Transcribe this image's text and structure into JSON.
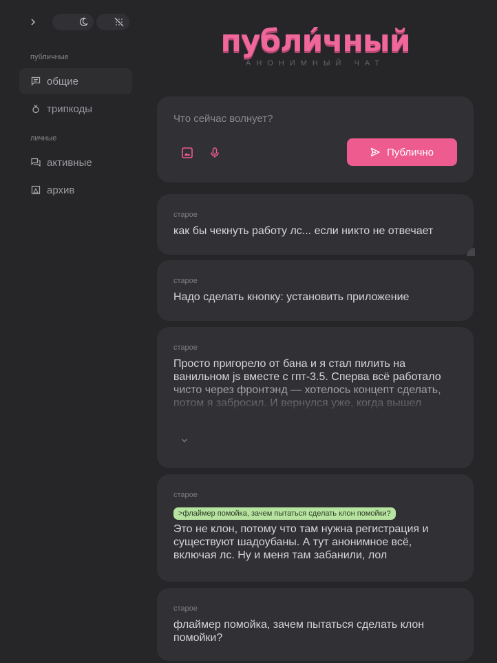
{
  "sidebar": {
    "sections": [
      {
        "label": "публичные",
        "items": [
          {
            "label": "общие",
            "icon": "chat-icon",
            "active": true
          },
          {
            "label": "трипкоды",
            "icon": "ring-icon",
            "active": false
          }
        ]
      },
      {
        "label": "личные",
        "items": [
          {
            "label": "активные",
            "icon": "conversations-icon",
            "active": false
          },
          {
            "label": "архив",
            "icon": "archive-icon",
            "active": false
          }
        ]
      }
    ]
  },
  "header": {
    "logo": "публи́чный",
    "subtitle": "анонимный чат"
  },
  "composer": {
    "placeholder": "Что сейчас волнует?",
    "publish_label": "Публично"
  },
  "posts": [
    {
      "meta": "старое",
      "text": "как бы чекнуть работу лс... если никто не отвечает"
    },
    {
      "meta": "старое",
      "text": "Надо сделать кнопку: установить приложение"
    },
    {
      "meta": "старое",
      "text": "Просто пригорело от бана и я стал пилить на ванильном js вместе с гпт-3.5. Сперва всё работало чисто через фронтэнд — хотелось концепт сделать, потом я забросил. И вернулся уже, когда вышел кодекс. Вместе с ним сделали бэкенд"
    },
    {
      "meta": "старое",
      "quote": ">флаймер помойка, зачем пытаться сделать клон помойки?",
      "text": "Это не клон, потому что там нужна регистрация и существуют шадоубаны. А тут анонимное всё, включая лс. Ну и меня там забанили, лол"
    },
    {
      "meta": "старое",
      "text": "флаймер помойка, зачем пытаться сделать клон помойки?"
    }
  ],
  "colors": {
    "background": "#262628",
    "card": "#313135",
    "accent": "#ee5b8f",
    "quote": "#b7e3a0"
  }
}
